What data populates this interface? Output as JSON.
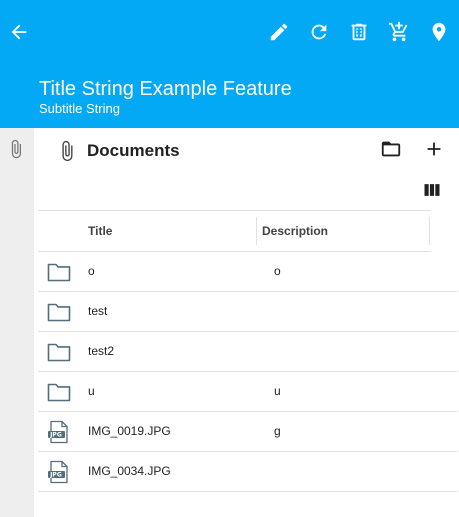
{
  "header": {
    "title": "Title String Example Feature",
    "subtitle": "Subtitle String",
    "back_icon": "arrow-back-icon",
    "actions": [
      "edit-icon",
      "refresh-icon",
      "delete-icon",
      "add-cart-icon",
      "location-icon"
    ],
    "background": "#03a9f4"
  },
  "side_rail": {
    "icon": "attachment-icon"
  },
  "panel": {
    "title": "Documents",
    "icon": "attachment-icon",
    "actions": [
      "folder-icon",
      "add-icon",
      "columns-icon"
    ]
  },
  "table": {
    "columns": [
      "Title",
      "Description"
    ],
    "rows": [
      {
        "type": "folder",
        "title": "o",
        "description": "o"
      },
      {
        "type": "folder",
        "title": "test",
        "description": ""
      },
      {
        "type": "folder",
        "title": "test2",
        "description": ""
      },
      {
        "type": "folder",
        "title": "u",
        "description": "u"
      },
      {
        "type": "jpg",
        "title": "IMG_0019.JPG",
        "description": "g"
      },
      {
        "type": "jpg",
        "title": "IMG_0034.JPG",
        "description": ""
      }
    ]
  }
}
